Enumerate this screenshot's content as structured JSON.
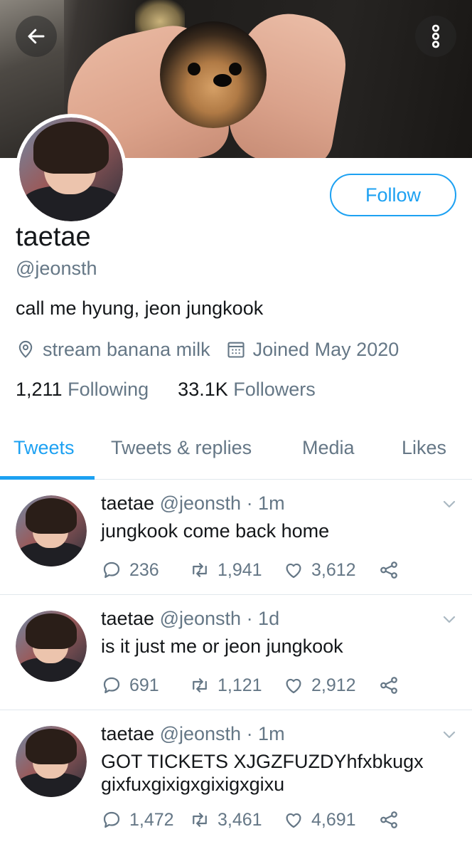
{
  "header": {
    "back_icon": "arrow-left-icon",
    "more_icon": "more-vertical-icon"
  },
  "profile": {
    "follow_label": "Follow",
    "display_name": "taetae",
    "handle": "@jeonsth",
    "bio": "call me hyung, jeon jungkook",
    "location": "stream banana milk",
    "joined": "Joined May 2020",
    "following_count": "1,211",
    "following_label": "Following",
    "followers_count": "33.1K",
    "followers_label": "Followers"
  },
  "tabs": [
    {
      "label": "Tweets",
      "active": true
    },
    {
      "label": "Tweets & replies",
      "active": false
    },
    {
      "label": "Media",
      "active": false
    },
    {
      "label": "Likes",
      "active": false
    }
  ],
  "tweets": [
    {
      "name": "taetae",
      "meta": "@jeonsth · 1m",
      "text": "jungkook come back home",
      "replies": "236",
      "retweets": "1,941",
      "likes": "3,612"
    },
    {
      "name": "taetae",
      "meta": "@jeonsth · 1d",
      "text": "is it just me or jeon jungkook",
      "replies": "691",
      "retweets": "1,121",
      "likes": "2,912"
    },
    {
      "name": "taetae",
      "meta": "@jeonsth · 1m",
      "text": "GOT TICKETS XJGZFUZDYhfxbkugx gixfuxgixigxgixigxgixu",
      "replies": "1,472",
      "retweets": "3,461",
      "likes": "4,691"
    }
  ],
  "colors": {
    "accent": "#1da1f2",
    "secondary_text": "#657786",
    "primary_text": "#14171a",
    "divider": "#e1e8ed"
  }
}
